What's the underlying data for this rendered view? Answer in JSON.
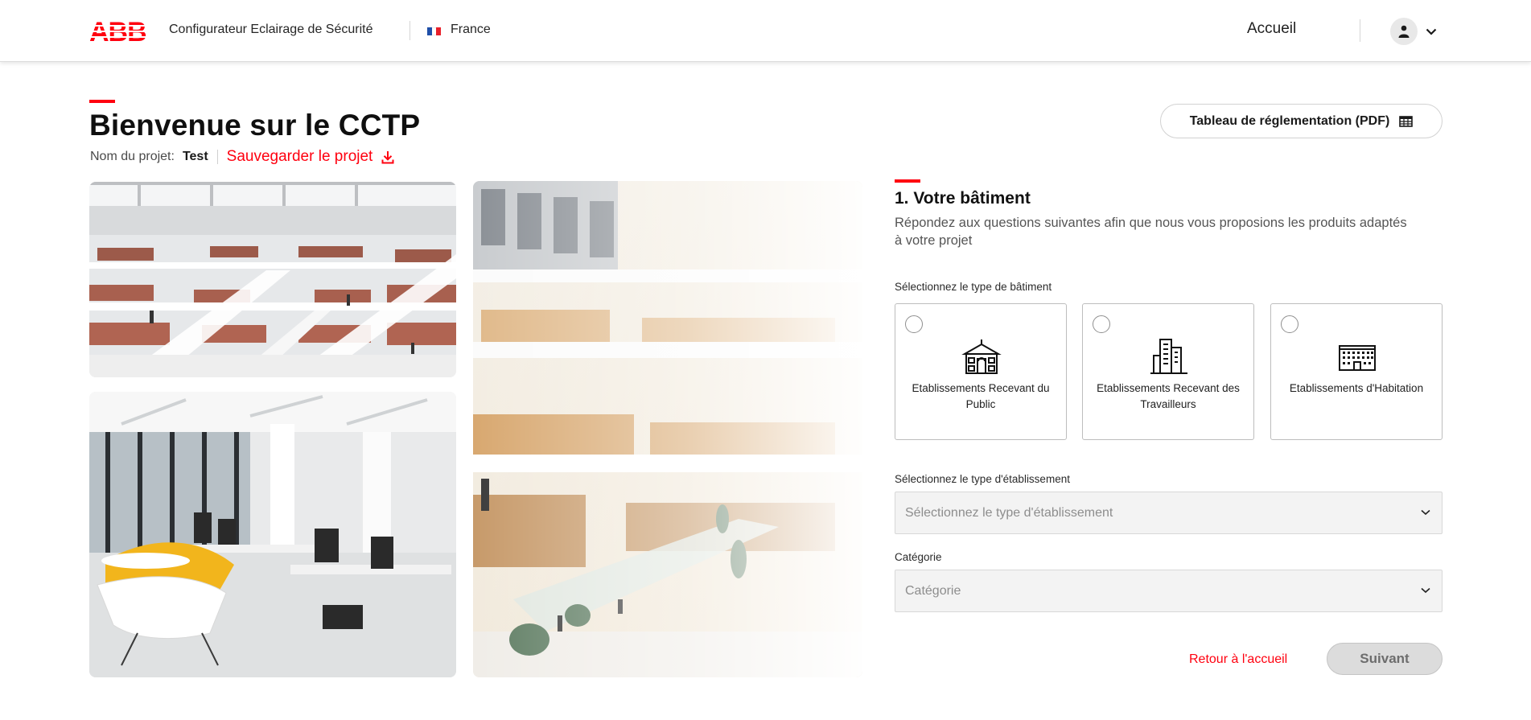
{
  "header": {
    "logo_text": "ABB",
    "app_title": "Configurateur Eclairage de Sécurité",
    "country": "France",
    "nav_home": "Accueil"
  },
  "page": {
    "title": "Bienvenue sur le CCTP",
    "project_label": "Nom du projet:",
    "project_name": "Test",
    "save_label": "Sauvegarder le projet",
    "pdf_button": "Tableau de réglementation (PDF)"
  },
  "form": {
    "section_title": "1. Votre bâtiment",
    "section_desc": "Répondez aux questions suivantes afin que nous vous proposions les produits adaptés à votre projet",
    "building_type_label": "Sélectionnez le type de bâtiment",
    "building_types": [
      {
        "label": "Etablissements Recevant du Public",
        "icon": "public-building-icon"
      },
      {
        "label": "Etablissements Recevant des Travailleurs",
        "icon": "office-tower-icon"
      },
      {
        "label": "Etablissements d'Habitation",
        "icon": "apartment-building-icon"
      }
    ],
    "establishment_label": "Sélectionnez le type d'établissement",
    "establishment_placeholder": "Sélectionnez le type d'établissement",
    "category_label": "Catégorie",
    "category_placeholder": "Catégorie",
    "back_label": "Retour à l'accueil",
    "next_label": "Suivant"
  },
  "colors": {
    "brand_red": "#ff000f",
    "border": "#bdbdbd",
    "select_bg": "#f3f3f3"
  }
}
